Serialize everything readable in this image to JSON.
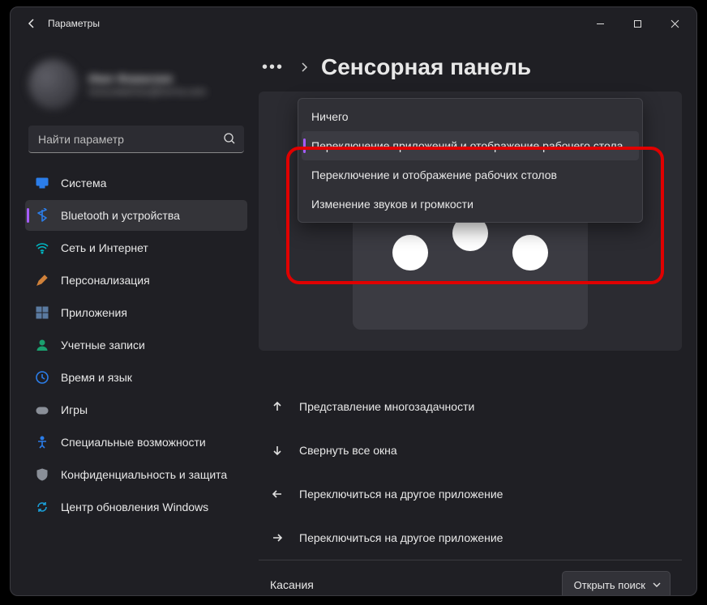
{
  "titlebar": {
    "title": "Параметры"
  },
  "profile": {
    "name": "Имя Фамилия",
    "email": "пользователь@почта.com"
  },
  "search": {
    "placeholder": "Найти параметр"
  },
  "sidebar": {
    "items": [
      {
        "label": "Система",
        "icon": "monitor",
        "color": "#2b7de9"
      },
      {
        "label": "Bluetooth и устройства",
        "icon": "bluetooth",
        "color": "#2b7de9",
        "active": true
      },
      {
        "label": "Сеть и Интернет",
        "icon": "wifi",
        "color": "#00b7c3"
      },
      {
        "label": "Персонализация",
        "icon": "brush",
        "color": "#d0813a"
      },
      {
        "label": "Приложения",
        "icon": "apps",
        "color": "#5a7aa0"
      },
      {
        "label": "Учетные записи",
        "icon": "person",
        "color": "#1aa06f"
      },
      {
        "label": "Время и язык",
        "icon": "clock",
        "color": "#2b7de9"
      },
      {
        "label": "Игры",
        "icon": "games",
        "color": "#8a8f98"
      },
      {
        "label": "Специальные возможности",
        "icon": "accessibility",
        "color": "#2b7de9"
      },
      {
        "label": "Конфиденциальность и защита",
        "icon": "shield",
        "color": "#8a8f98"
      },
      {
        "label": "Центр обновления Windows",
        "icon": "update",
        "color": "#1a9fd8"
      }
    ]
  },
  "breadcrumb": {
    "ellipsis": "•••",
    "page_title": "Сенсорная панель"
  },
  "dropdown": {
    "items": [
      {
        "label": "Ничего"
      },
      {
        "label": "Переключение приложений и отображение рабочего стола",
        "selected": true
      },
      {
        "label": "Переключение и отображение рабочих столов"
      },
      {
        "label": "Изменение звуков и громкости"
      }
    ]
  },
  "rows": [
    {
      "icon": "arrow-up",
      "label": "Представление многозадачности"
    },
    {
      "icon": "arrow-down",
      "label": "Свернуть все окна"
    },
    {
      "icon": "arrow-left",
      "label": "Переключиться на другое приложение"
    },
    {
      "icon": "arrow-right",
      "label": "Переключиться на другое приложение"
    }
  ],
  "footer": {
    "label": "Касания",
    "button": "Открыть поиск"
  }
}
